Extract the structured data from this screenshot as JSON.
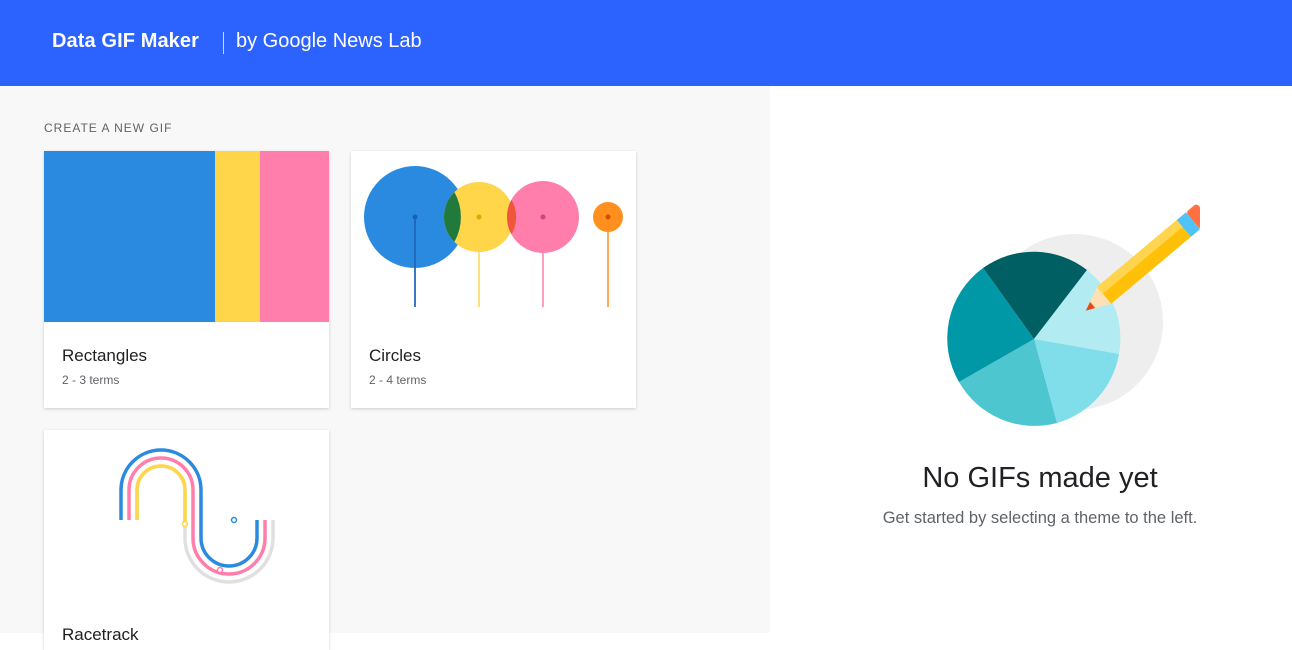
{
  "header": {
    "brand": "Data GIF Maker",
    "byline": "by Google News Lab",
    "background": "#2c63ff"
  },
  "create": {
    "section_title": "CREATE A NEW GIF",
    "cards": [
      {
        "title": "Rectangles",
        "subtitle": "2 - 3 terms",
        "icon": "rectangles-thumbnail"
      },
      {
        "title": "Circles",
        "subtitle": "2 - 4 terms",
        "icon": "circles-thumbnail"
      },
      {
        "title": "Racetrack",
        "subtitle": "",
        "icon": "racetrack-thumbnail"
      }
    ]
  },
  "empty_state": {
    "title": "No GIFs made yet",
    "subtitle": "Get started by selecting a theme to the left.",
    "icon": "pie-chart-pencil-illustration"
  },
  "colors": {
    "blue": "#2a8ae0",
    "yellow": "#ffd54a",
    "pink": "#ff7eab",
    "orange": "#ff8f1f",
    "teal_dark": "#005f63",
    "teal": "#0097a7"
  }
}
